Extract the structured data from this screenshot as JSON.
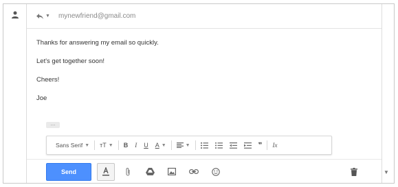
{
  "header": {
    "reply_icon_name": "reply-icon",
    "recipient": "mynewfriend@gmail.com"
  },
  "body": {
    "lines": [
      "Thanks for answering my email so quickly.",
      "Let's get together soon!",
      "Cheers!",
      "Joe"
    ],
    "trimmed_content_label": "..."
  },
  "format_bar": {
    "font_label": "Sans Serif",
    "size_label": "тT",
    "bold": "B",
    "italic": "I",
    "underline": "U",
    "text_color": "A",
    "quote": "❞",
    "remove_format": "Ix"
  },
  "bottom_bar": {
    "send_label": "Send"
  },
  "colors": {
    "send_bg": "#4d90fe",
    "icon": "#6f6f6f"
  }
}
